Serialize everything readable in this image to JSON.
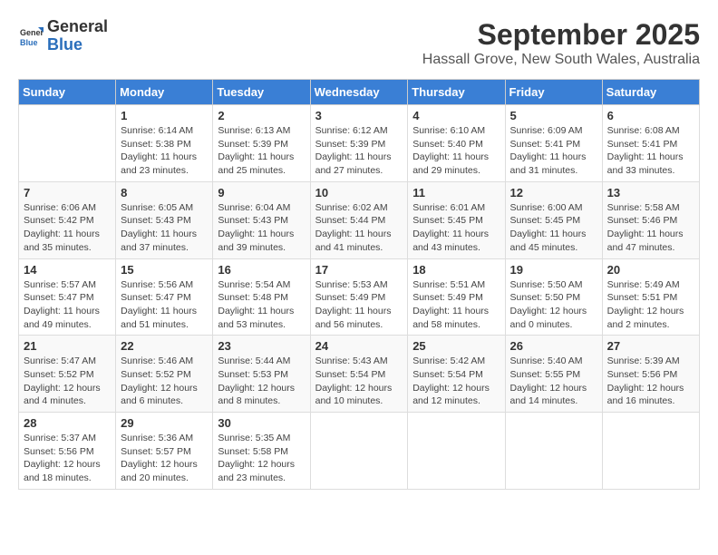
{
  "header": {
    "logo_line1": "General",
    "logo_line2": "Blue",
    "month": "September 2025",
    "location": "Hassall Grove, New South Wales, Australia"
  },
  "weekdays": [
    "Sunday",
    "Monday",
    "Tuesday",
    "Wednesday",
    "Thursday",
    "Friday",
    "Saturday"
  ],
  "weeks": [
    [
      {
        "day": "",
        "info": ""
      },
      {
        "day": "1",
        "info": "Sunrise: 6:14 AM\nSunset: 5:38 PM\nDaylight: 11 hours\nand 23 minutes."
      },
      {
        "day": "2",
        "info": "Sunrise: 6:13 AM\nSunset: 5:39 PM\nDaylight: 11 hours\nand 25 minutes."
      },
      {
        "day": "3",
        "info": "Sunrise: 6:12 AM\nSunset: 5:39 PM\nDaylight: 11 hours\nand 27 minutes."
      },
      {
        "day": "4",
        "info": "Sunrise: 6:10 AM\nSunset: 5:40 PM\nDaylight: 11 hours\nand 29 minutes."
      },
      {
        "day": "5",
        "info": "Sunrise: 6:09 AM\nSunset: 5:41 PM\nDaylight: 11 hours\nand 31 minutes."
      },
      {
        "day": "6",
        "info": "Sunrise: 6:08 AM\nSunset: 5:41 PM\nDaylight: 11 hours\nand 33 minutes."
      }
    ],
    [
      {
        "day": "7",
        "info": "Sunrise: 6:06 AM\nSunset: 5:42 PM\nDaylight: 11 hours\nand 35 minutes."
      },
      {
        "day": "8",
        "info": "Sunrise: 6:05 AM\nSunset: 5:43 PM\nDaylight: 11 hours\nand 37 minutes."
      },
      {
        "day": "9",
        "info": "Sunrise: 6:04 AM\nSunset: 5:43 PM\nDaylight: 11 hours\nand 39 minutes."
      },
      {
        "day": "10",
        "info": "Sunrise: 6:02 AM\nSunset: 5:44 PM\nDaylight: 11 hours\nand 41 minutes."
      },
      {
        "day": "11",
        "info": "Sunrise: 6:01 AM\nSunset: 5:45 PM\nDaylight: 11 hours\nand 43 minutes."
      },
      {
        "day": "12",
        "info": "Sunrise: 6:00 AM\nSunset: 5:45 PM\nDaylight: 11 hours\nand 45 minutes."
      },
      {
        "day": "13",
        "info": "Sunrise: 5:58 AM\nSunset: 5:46 PM\nDaylight: 11 hours\nand 47 minutes."
      }
    ],
    [
      {
        "day": "14",
        "info": "Sunrise: 5:57 AM\nSunset: 5:47 PM\nDaylight: 11 hours\nand 49 minutes."
      },
      {
        "day": "15",
        "info": "Sunrise: 5:56 AM\nSunset: 5:47 PM\nDaylight: 11 hours\nand 51 minutes."
      },
      {
        "day": "16",
        "info": "Sunrise: 5:54 AM\nSunset: 5:48 PM\nDaylight: 11 hours\nand 53 minutes."
      },
      {
        "day": "17",
        "info": "Sunrise: 5:53 AM\nSunset: 5:49 PM\nDaylight: 11 hours\nand 56 minutes."
      },
      {
        "day": "18",
        "info": "Sunrise: 5:51 AM\nSunset: 5:49 PM\nDaylight: 11 hours\nand 58 minutes."
      },
      {
        "day": "19",
        "info": "Sunrise: 5:50 AM\nSunset: 5:50 PM\nDaylight: 12 hours\nand 0 minutes."
      },
      {
        "day": "20",
        "info": "Sunrise: 5:49 AM\nSunset: 5:51 PM\nDaylight: 12 hours\nand 2 minutes."
      }
    ],
    [
      {
        "day": "21",
        "info": "Sunrise: 5:47 AM\nSunset: 5:52 PM\nDaylight: 12 hours\nand 4 minutes."
      },
      {
        "day": "22",
        "info": "Sunrise: 5:46 AM\nSunset: 5:52 PM\nDaylight: 12 hours\nand 6 minutes."
      },
      {
        "day": "23",
        "info": "Sunrise: 5:44 AM\nSunset: 5:53 PM\nDaylight: 12 hours\nand 8 minutes."
      },
      {
        "day": "24",
        "info": "Sunrise: 5:43 AM\nSunset: 5:54 PM\nDaylight: 12 hours\nand 10 minutes."
      },
      {
        "day": "25",
        "info": "Sunrise: 5:42 AM\nSunset: 5:54 PM\nDaylight: 12 hours\nand 12 minutes."
      },
      {
        "day": "26",
        "info": "Sunrise: 5:40 AM\nSunset: 5:55 PM\nDaylight: 12 hours\nand 14 minutes."
      },
      {
        "day": "27",
        "info": "Sunrise: 5:39 AM\nSunset: 5:56 PM\nDaylight: 12 hours\nand 16 minutes."
      }
    ],
    [
      {
        "day": "28",
        "info": "Sunrise: 5:37 AM\nSunset: 5:56 PM\nDaylight: 12 hours\nand 18 minutes."
      },
      {
        "day": "29",
        "info": "Sunrise: 5:36 AM\nSunset: 5:57 PM\nDaylight: 12 hours\nand 20 minutes."
      },
      {
        "day": "30",
        "info": "Sunrise: 5:35 AM\nSunset: 5:58 PM\nDaylight: 12 hours\nand 23 minutes."
      },
      {
        "day": "",
        "info": ""
      },
      {
        "day": "",
        "info": ""
      },
      {
        "day": "",
        "info": ""
      },
      {
        "day": "",
        "info": ""
      }
    ]
  ]
}
